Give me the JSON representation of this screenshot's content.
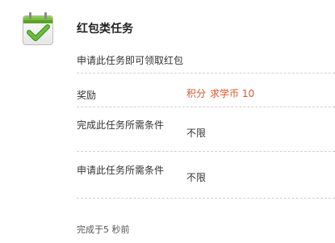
{
  "task": {
    "icon": "calendar-check-icon",
    "title": "红包类任务",
    "description": "申请此任务即可领取红包"
  },
  "rows": [
    {
      "label": "奖励",
      "value_parts": [
        "积分",
        "求学币 10"
      ]
    },
    {
      "label": "完成此任务所需条件",
      "value": "不限"
    },
    {
      "label": "申请此任务所需条件",
      "value": "不限"
    }
  ],
  "footer": {
    "text": "完成于5 秒前"
  },
  "colors": {
    "accent": "#d9572a",
    "icon_green": "#67b52a",
    "divider": "#cfcfcf"
  }
}
